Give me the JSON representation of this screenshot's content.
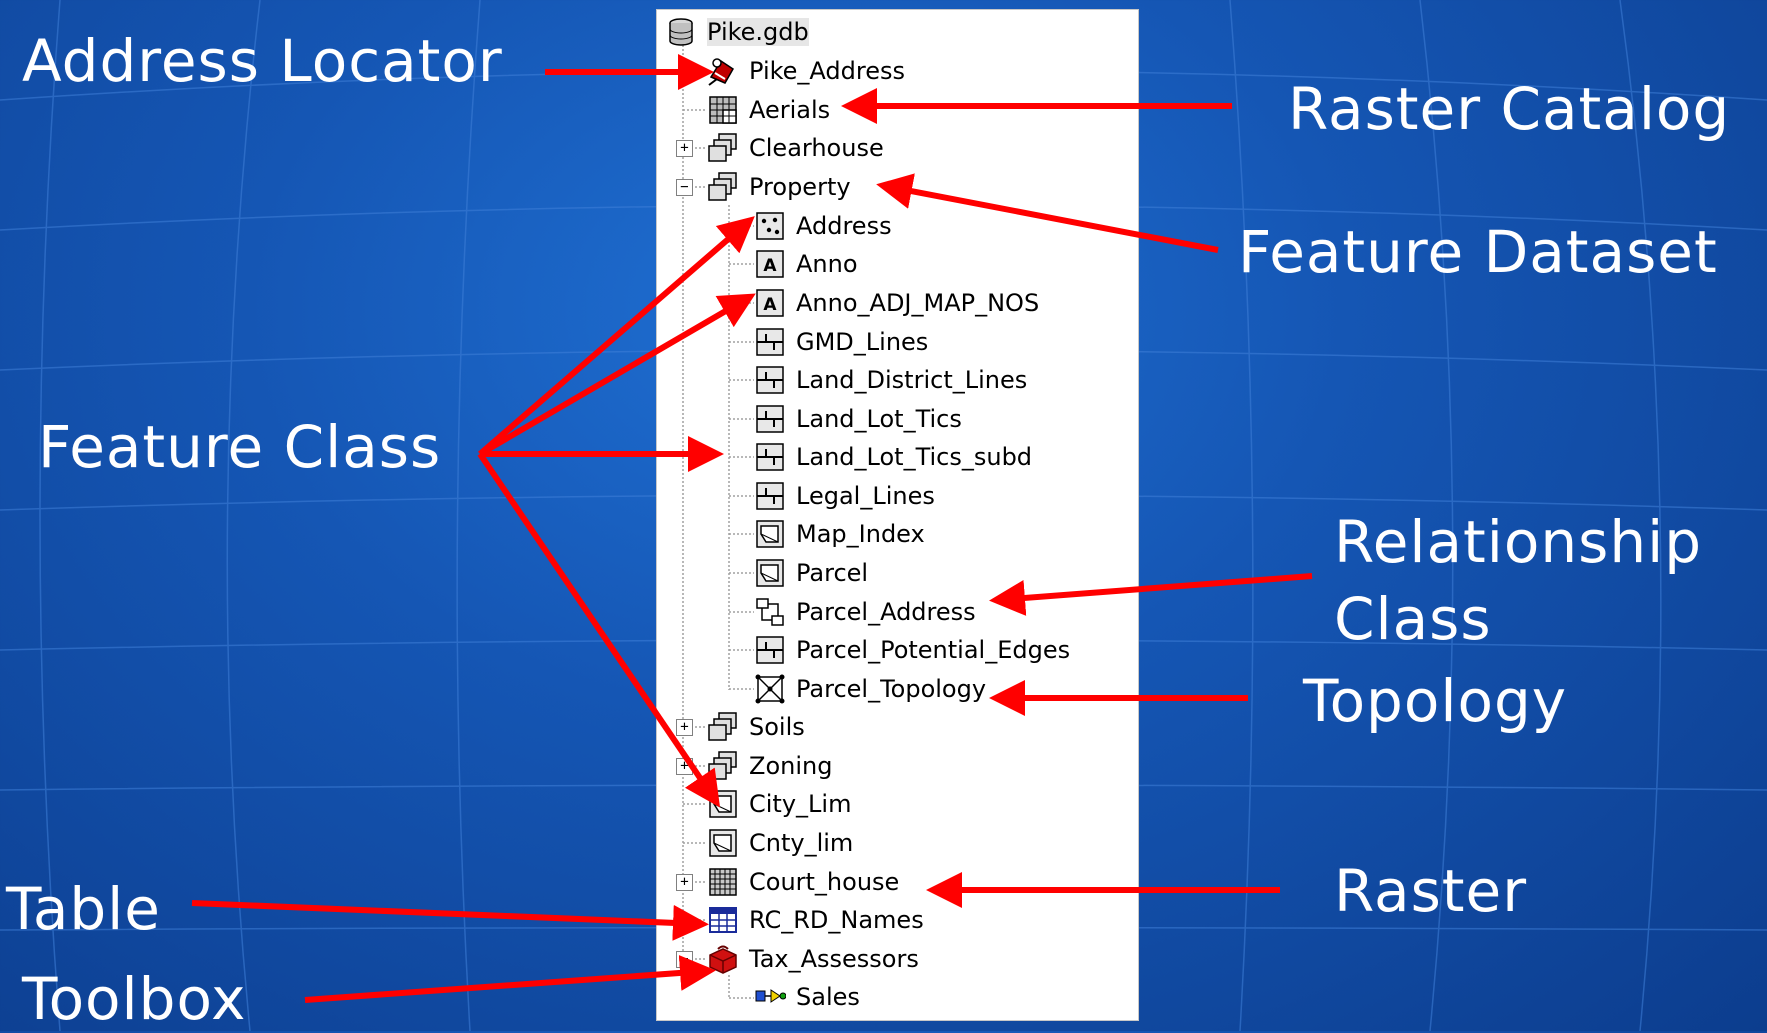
{
  "tree": {
    "root": {
      "label": "Pike.gdb",
      "icon": "geodatabase-icon"
    },
    "items": [
      {
        "label": "Pike_Address",
        "icon": "address-locator-icon"
      },
      {
        "label": "Aerials",
        "icon": "raster-catalog-icon"
      },
      {
        "label": "Clearhouse",
        "icon": "feature-dataset-icon",
        "expander": "+"
      },
      {
        "label": "Property",
        "icon": "feature-dataset-icon",
        "expander": "−"
      },
      {
        "label": "Address",
        "icon": "point-feature-class-icon"
      },
      {
        "label": "Anno",
        "icon": "annotation-class-icon"
      },
      {
        "label": "Anno_ADJ_MAP_NOS",
        "icon": "annotation-class-icon"
      },
      {
        "label": "GMD_Lines",
        "icon": "line-feature-class-icon"
      },
      {
        "label": "Land_District_Lines",
        "icon": "line-feature-class-icon"
      },
      {
        "label": "Land_Lot_Tics",
        "icon": "line-feature-class-icon"
      },
      {
        "label": "Land_Lot_Tics_subd",
        "icon": "line-feature-class-icon"
      },
      {
        "label": "Legal_Lines",
        "icon": "line-feature-class-icon"
      },
      {
        "label": "Map_Index",
        "icon": "polygon-feature-class-icon"
      },
      {
        "label": "Parcel",
        "icon": "polygon-feature-class-icon"
      },
      {
        "label": "Parcel_Address",
        "icon": "relationship-class-icon"
      },
      {
        "label": "Parcel_Potential_Edges",
        "icon": "line-feature-class-icon"
      },
      {
        "label": "Parcel_Topology",
        "icon": "topology-icon"
      },
      {
        "label": "Soils",
        "icon": "feature-dataset-icon",
        "expander": "+"
      },
      {
        "label": "Zoning",
        "icon": "feature-dataset-icon",
        "expander": "+"
      },
      {
        "label": "City_Lim",
        "icon": "polygon-feature-class-icon"
      },
      {
        "label": "Cnty_lim",
        "icon": "polygon-feature-class-icon"
      },
      {
        "label": "Court_house",
        "icon": "raster-icon",
        "expander": "+"
      },
      {
        "label": "RC_RD_Names",
        "icon": "table-icon"
      },
      {
        "label": "Tax_Assessors",
        "icon": "toolbox-icon",
        "expander": "−"
      },
      {
        "label": "Sales",
        "icon": "model-tool-icon"
      }
    ]
  },
  "callouts": {
    "address_locator": "Address Locator",
    "raster_catalog": "Raster Catalog",
    "feature_dataset": "Feature Dataset",
    "feature_class": "Feature Class",
    "relationship_class_line1": "Relationship",
    "relationship_class_line2": "Class",
    "topology": "Topology",
    "raster": "Raster",
    "table": "Table",
    "toolbox": "Toolbox"
  },
  "colors": {
    "background": "#1556b4",
    "callout_text": "#ffffff",
    "arrow": "#ff0000",
    "panel": "#ffffff"
  }
}
